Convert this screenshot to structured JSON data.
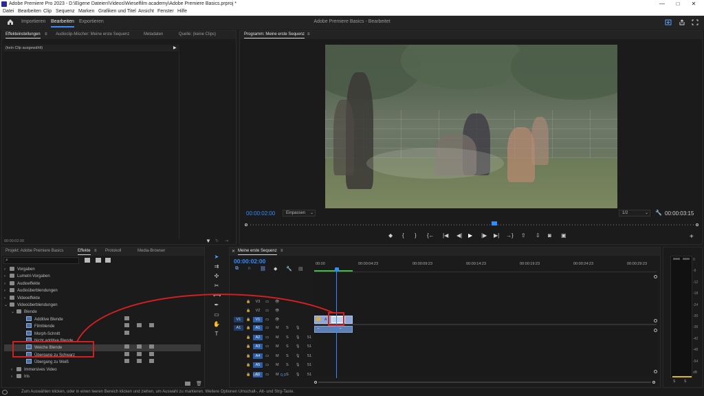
{
  "window": {
    "title": "Adobe Premiere Pro 2023 - D:\\Eigene Dateien\\Videos\\Wieselfilm academy\\Adobe Premiere Basics.prproj *",
    "minimize": "—",
    "maximize": "□",
    "close": "✕"
  },
  "menu": [
    "Datei",
    "Bearbeiten",
    "Clip",
    "Sequenz",
    "Marken",
    "Grafiken und Titel",
    "Ansicht",
    "Fenster",
    "Hilfe"
  ],
  "workspace": {
    "tabs": [
      "Importieren",
      "Bearbeiten",
      "Exportieren"
    ],
    "active": "Bearbeiten",
    "project": "Adobe Premiere Basics",
    "separator": " - ",
    "status": "Bearbeitet"
  },
  "source_panel": {
    "tabs": [
      "Effekteinstellungen",
      "Audioclip-Mischer: Meine erste Sequenz",
      "Metadaten",
      "Quelle: (keine Clips)"
    ],
    "no_clip": "(kein Clip ausgewählt)",
    "timecode": "00:00:02:00"
  },
  "program": {
    "tab": "Programm: Meine erste Sequenz",
    "timecode": "00:00:02:00",
    "fit": "Einpassen",
    "resolution": "1/2",
    "duration": "00:00:03:15",
    "playhead_fraction": 0.55
  },
  "project_panel": {
    "tabs": [
      "Projekt: Adobe Premiere Basics",
      "Effekte",
      "Protokoll",
      "Media-Browser"
    ],
    "active": "Effekte",
    "tree": [
      {
        "label": "Vorgaben",
        "level": 0,
        "type": "folder",
        "open": false
      },
      {
        "label": "Lumetri-Vorgaben",
        "level": 0,
        "type": "folder",
        "open": false
      },
      {
        "label": "Audioeffekte",
        "level": 0,
        "type": "folder",
        "open": false
      },
      {
        "label": "Audioüberblendungen",
        "level": 0,
        "type": "folder",
        "open": false
      },
      {
        "label": "Videoeffekte",
        "level": 0,
        "type": "folder",
        "open": false
      },
      {
        "label": "Videoüberblendungen",
        "level": 0,
        "type": "folder",
        "open": true
      },
      {
        "label": "Blende",
        "level": 1,
        "type": "folder",
        "open": true
      },
      {
        "label": "Additive Blende",
        "level": 2,
        "type": "fx",
        "badges": 1
      },
      {
        "label": "Filmblende",
        "level": 2,
        "type": "fx",
        "badges": 3
      },
      {
        "label": "Morph-Schnitt",
        "level": 2,
        "type": "fx",
        "badges": 1
      },
      {
        "label": "Nicht additive Blende",
        "level": 2,
        "type": "fx",
        "badges": 0
      },
      {
        "label": "Weiche Blende",
        "level": 2,
        "type": "fx",
        "badges": 3,
        "selected": true
      },
      {
        "label": "Übergang zu Schwarz",
        "level": 2,
        "type": "fx",
        "badges": 3
      },
      {
        "label": "Übergang zu Weiß",
        "level": 2,
        "type": "fx",
        "badges": 3
      },
      {
        "label": "Immersives Video",
        "level": 1,
        "type": "folder",
        "open": false
      },
      {
        "label": "Iris",
        "level": 1,
        "type": "folder",
        "open": false
      }
    ]
  },
  "timeline": {
    "tab": "Meine erste Sequenz",
    "timecode": "00:00:02:00",
    "ruler": [
      "00:00",
      "00:00:04:23",
      "00:00:09:23",
      "00:00:14:23",
      "00:00:19:23",
      "00:00:24:23",
      "00:00:29:23"
    ],
    "video_tracks": [
      "V3",
      "V2",
      "V1"
    ],
    "audio_tracks": [
      "A1",
      "A2",
      "A3",
      "A4",
      "A5",
      "A6"
    ],
    "v_targets": [
      "V1"
    ],
    "a_targets": [
      "A1"
    ],
    "mix_label": "Mix",
    "mix_value": "0,0",
    "m_label": "M",
    "s_label": "S",
    "a_clip_label": "51"
  },
  "meter": {
    "scale": [
      "0",
      "-6",
      "-12",
      "-18",
      "-24",
      "-30",
      "-36",
      "-42",
      "-48",
      "-54",
      "dB"
    ],
    "s_labels": [
      "S",
      "S"
    ]
  },
  "statusbar": {
    "text": "Zum Auswählen klicken, oder in einen leeren Bereich klicken und ziehen, um Auswahl zu markieren. Weitere Optionen Umschalt-, Alt- und Strg-Taste."
  },
  "colors": {
    "accent": "#3f8cff",
    "annotation": "#d21f1f",
    "clip_video": "#8fa6d6",
    "clip_audio": "#5d7fb3"
  }
}
